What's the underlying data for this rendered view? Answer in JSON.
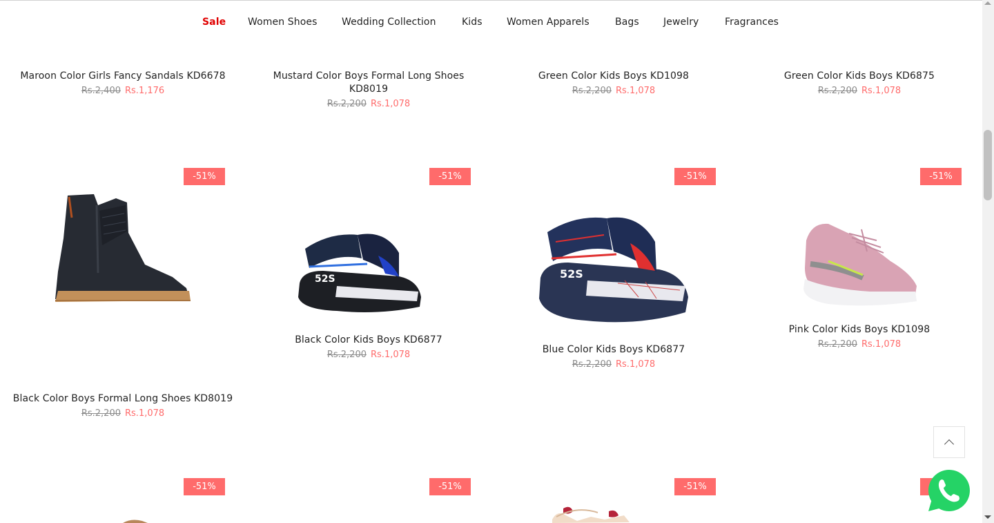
{
  "nav": {
    "items": [
      {
        "label": "Sale",
        "active": true
      },
      {
        "label": "Women Shoes"
      },
      {
        "label": "Wedding Collection"
      },
      {
        "label": "Kids"
      },
      {
        "label": "Women Apparels"
      },
      {
        "label": "Bags"
      },
      {
        "label": "Jewelry"
      },
      {
        "label": "Fragrances"
      }
    ]
  },
  "row1": [
    {
      "title": "Maroon Color Girls Fancy Sandals KD6678",
      "old_price": "Rs.2,400",
      "new_price": "Rs.1,176"
    },
    {
      "title": "Mustard Color Boys Formal Long Shoes KD8019",
      "old_price": "Rs.2,200",
      "new_price": "Rs.1,078"
    },
    {
      "title": "Green Color Kids Boys KD1098",
      "old_price": "Rs.2,200",
      "new_price": "Rs.1,078"
    },
    {
      "title": "Green Color Kids Boys KD6875",
      "old_price": "Rs.2,200",
      "new_price": "Rs.1,078"
    }
  ],
  "row2": [
    {
      "badge": "-51%",
      "title": "Black Color Boys Formal Long Shoes KD8019",
      "old_price": "Rs.2,200",
      "new_price": "Rs.1,078",
      "image": "black-chelsea-boot"
    },
    {
      "badge": "-51%",
      "title": "Black Color Kids Boys KD6877",
      "old_price": "Rs.2,200",
      "new_price": "Rs.1,078",
      "image": "black-sport-sandal"
    },
    {
      "badge": "-51%",
      "title": "Blue Color Kids Boys KD6877",
      "old_price": "Rs.2,200",
      "new_price": "Rs.1,078",
      "image": "blue-sport-sandal"
    },
    {
      "badge": "-51%",
      "title": "Pink Color Kids Boys KD1098",
      "old_price": "Rs.2,200",
      "new_price": "Rs.1,078",
      "image": "pink-knit-sneaker"
    }
  ],
  "row3": [
    {
      "badge": "-51%"
    },
    {
      "badge": "-51%"
    },
    {
      "badge": "-51%"
    },
    {
      "badge": "-51%"
    }
  ],
  "icons": {
    "back_to_top": "chevron-up-icon",
    "whatsapp": "whatsapp-icon"
  },
  "colors": {
    "accent_sale": "#e00000",
    "price_new": "#ff6b6b",
    "badge_bg": "#ff6b6b",
    "whatsapp_green": "#25d366"
  }
}
